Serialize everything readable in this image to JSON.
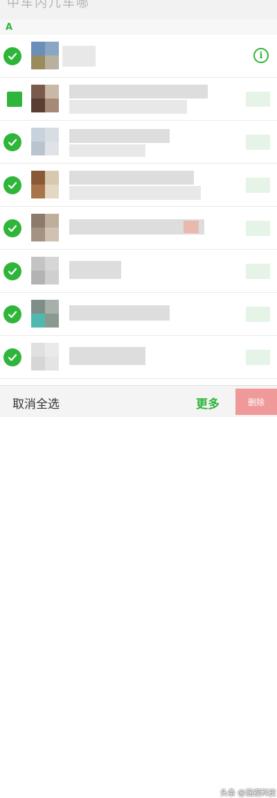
{
  "header": {
    "title_partial": "中车内几车哪"
  },
  "section": {
    "letter": "A"
  },
  "contacts": [
    {
      "name": "",
      "selected": true,
      "has_info_icon": true
    },
    {
      "name": "",
      "selected": true,
      "has_info_icon": false
    },
    {
      "name": "",
      "selected": true,
      "has_info_icon": false
    },
    {
      "name": "",
      "selected": true,
      "has_info_icon": false
    },
    {
      "name": "",
      "selected": true,
      "has_info_icon": false
    },
    {
      "name": "",
      "selected": true,
      "has_info_icon": false
    },
    {
      "name": "",
      "selected": true,
      "has_info_icon": false
    },
    {
      "name": "",
      "selected": true,
      "has_info_icon": false
    }
  ],
  "icons": {
    "check": "checkmark-icon",
    "info": "info-icon"
  },
  "bottom_bar": {
    "cancel_all_label": "取消全选",
    "more_label": "更多",
    "delete_label": "删除"
  },
  "watermark": "头条 @涵视科技",
  "colors": {
    "accent": "#2fb53a",
    "delete": "#f08a8a"
  }
}
